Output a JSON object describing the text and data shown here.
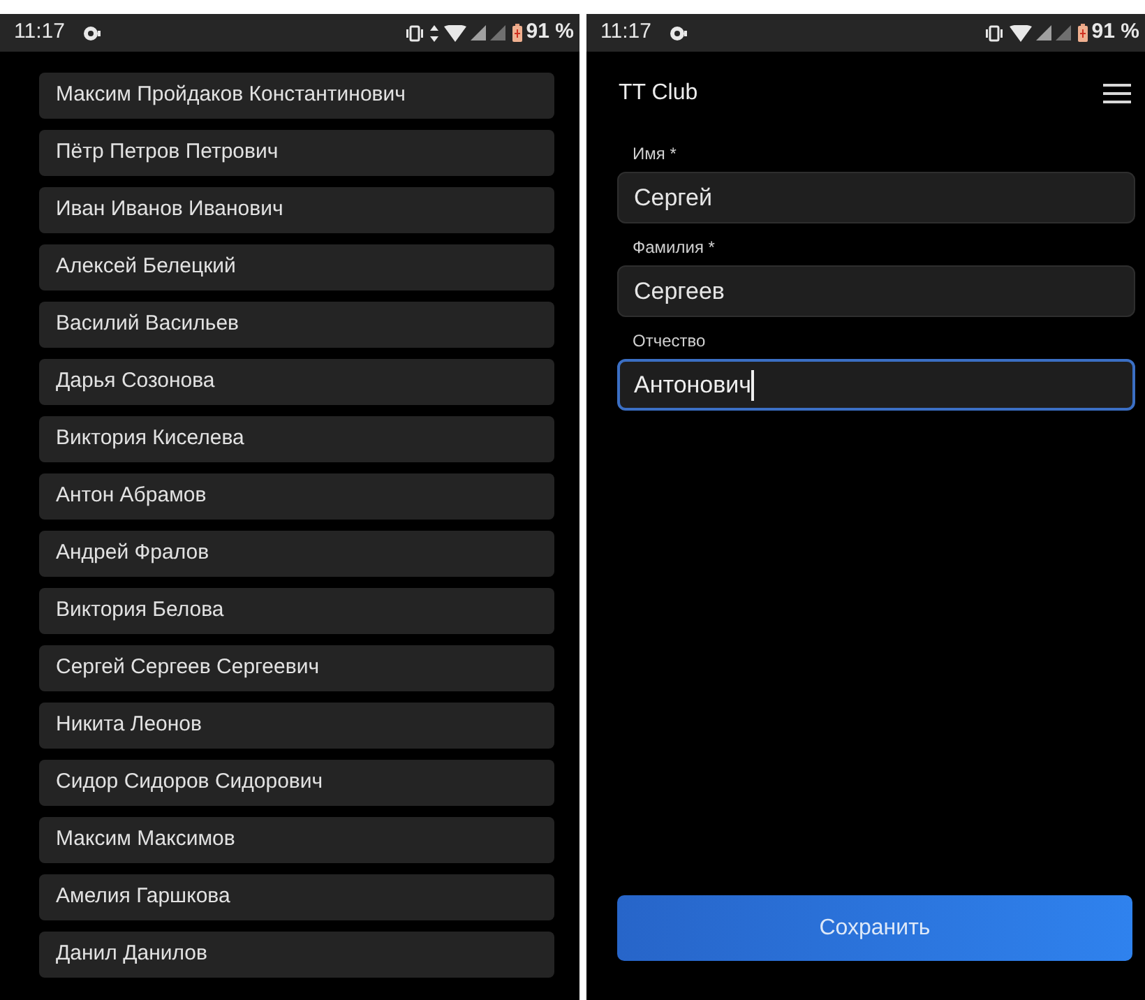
{
  "screens": [
    {
      "kind": "list",
      "status_bar": {
        "time": "11:17",
        "battery": "91 %",
        "data_activity": true
      },
      "items": [
        "Максим Пройдаков Константинович",
        "Пётр Петров Петрович",
        "Иван Иванов Иванович",
        "Алексей Белецкий",
        "Василий Васильев",
        "Дарья Созонова",
        "Виктория Киселева",
        "Антон Абрамов",
        "Андрей Фралов",
        "Виктория Белова",
        "Сергей Сергеев Сергеевич",
        "Никита Леонов",
        "Сидор Сидоров Сидорович",
        "Максим Максимов",
        "Амелия Гаршкова",
        "Данил Данилов"
      ]
    },
    {
      "kind": "form",
      "status_bar": {
        "time": "11:17",
        "battery": "91 %",
        "data_activity": false
      },
      "app_title": "TT Club",
      "fields": [
        {
          "label": "Имя *",
          "value": "Сергей",
          "focused": false
        },
        {
          "label": "Фамилия *",
          "value": "Сергеев",
          "focused": false
        },
        {
          "label": "Отчество",
          "value": "Антонович",
          "focused": true
        }
      ],
      "save_button": "Сохранить"
    }
  ]
}
